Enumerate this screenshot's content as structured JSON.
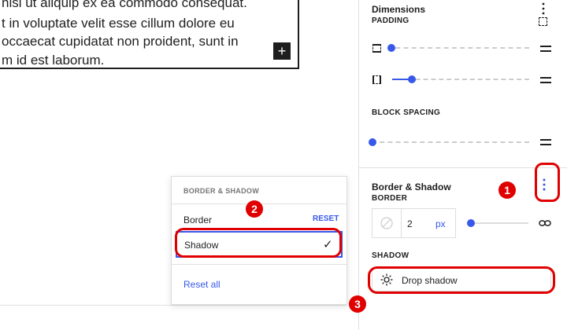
{
  "editor": {
    "paragraph_lines": [
      "nisi ut aliquip ex ea commodo consequat.",
      "t in voluptate velit esse cillum dolore eu",
      "occaecat cupidatat non proident, sunt in",
      "m id est laborum."
    ],
    "add_block_symbol": "+"
  },
  "sidebar": {
    "dimensions": {
      "title": "Dimensions",
      "padding_label": "PADDING",
      "block_spacing_label": "BLOCK SPACING",
      "padding_vertical_value": 0,
      "padding_horizontal_value": 0.2,
      "block_spacing_value": 0
    },
    "border_shadow": {
      "title": "Border & Shadow",
      "border_label": "BORDER",
      "border_width": "2",
      "border_unit": "px",
      "border_slider_value": 0,
      "shadow_label": "SHADOW",
      "drop_shadow_label": "Drop shadow"
    }
  },
  "popover": {
    "heading": "BORDER & SHADOW",
    "items": [
      {
        "label": "Border",
        "action": "RESET"
      },
      {
        "label": "Shadow",
        "checked": true
      }
    ],
    "check_mark": "✓",
    "reset_all": "Reset all"
  },
  "annotations": {
    "badges": [
      "1",
      "2",
      "3"
    ],
    "color": "#e00000"
  },
  "colors": {
    "accent": "#3858e9",
    "text": "#1e1e1e",
    "annotation": "#e00000"
  }
}
